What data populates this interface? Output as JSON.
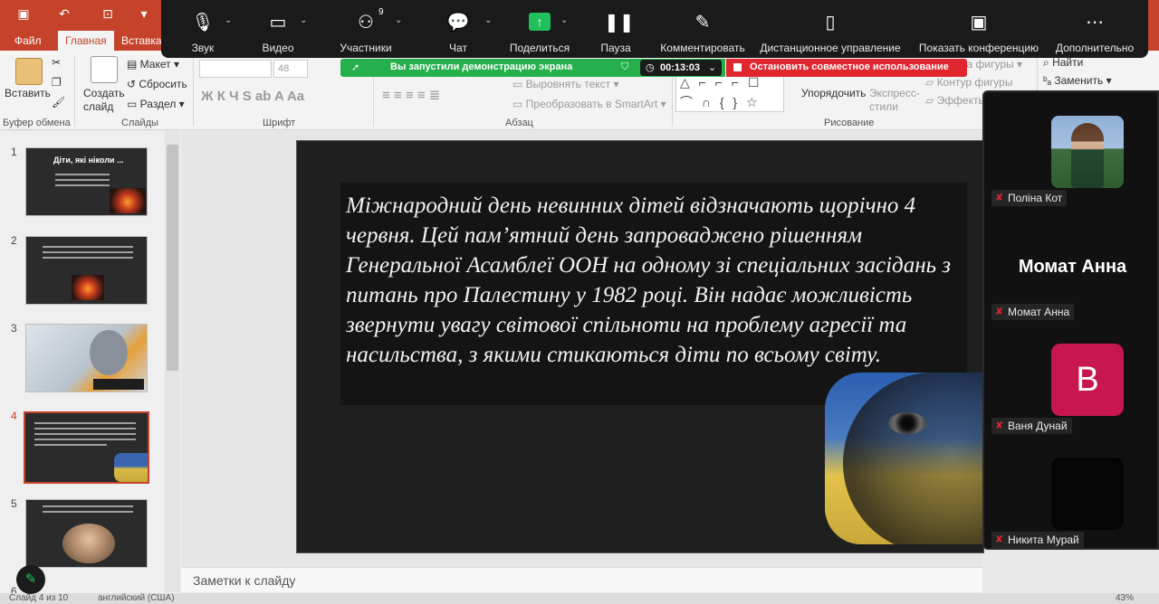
{
  "ppt": {
    "tabs": [
      {
        "label": "Файл"
      },
      {
        "label": "Главная"
      },
      {
        "label": "Вставка"
      }
    ],
    "ribbon": {
      "paste_label": "Вставить",
      "clipboard_group": "Буфер обмена",
      "new_slide_label": "Создать слайд",
      "layout_label": "Макет",
      "reset_label": "Сбросить",
      "section_label": "Раздел",
      "slides_group": "Слайды",
      "font_size": "48",
      "font_group": "Шрифт",
      "align_text_label": "Выровнять текст",
      "smartart_label": "Преобразовать в SmartArt",
      "paragraph_group": "Абзац",
      "arrange_label": "Упорядочить",
      "quick_styles_label": "Экспресс-стили",
      "shape_fill_label": "ка фигуры",
      "shape_outline_label": "Контур фигуры",
      "effects_label": "Эффекты",
      "drawing_group": "Рисование",
      "find_label": "Найти",
      "replace_label": "Заменить"
    },
    "slides": [
      {
        "num": "1",
        "title": "Діти, які ніколи ..."
      },
      {
        "num": "2"
      },
      {
        "num": "3"
      },
      {
        "num": "4"
      },
      {
        "num": "5"
      },
      {
        "num": "6"
      }
    ],
    "current_slide_text": " Міжнародний день невинних дітей відзначають щорічно 4 червня. Цей пам’ятний день запроваджено рішенням Генеральної Асамблеї ООН на одному зі спеціальних засідань з питань про Палестину у 1982 році. Він надає можливість звернути увагу світової спільноти на проблему агресії та насильства, з якими стикаються діти по всьому світу.",
    "notes_placeholder": "Заметки к слайду",
    "status": {
      "slide_counter": "Слайд 4 из 10",
      "language": "английский (США)",
      "zoom": "43%"
    }
  },
  "zoom": {
    "toolbar": [
      {
        "label": "Звук",
        "icon": "microphone-icon"
      },
      {
        "label": "Видео",
        "icon": "video-camera-icon"
      },
      {
        "label": "Участники",
        "icon": "participants-icon",
        "badge": "9"
      },
      {
        "label": "Чат",
        "icon": "chat-icon"
      },
      {
        "label": "Поделиться",
        "icon": "share-screen-icon"
      },
      {
        "label": "Пауза",
        "icon": "pause-icon"
      },
      {
        "label": "Комментировать",
        "icon": "annotate-pencil-icon"
      },
      {
        "label": "Дистанционное управление",
        "icon": "remote-control-mouse-icon"
      },
      {
        "label": "Показать конференцию",
        "icon": "show-meeting-icon"
      },
      {
        "label": "Дополнительно",
        "icon": "more-icon"
      }
    ],
    "share_banner": "Вы запустили демонстрацию экрана",
    "timer": "00:13:03",
    "stop_share": "Остановить совместное использование",
    "participants": [
      {
        "name": "Поліна Кот",
        "avatar": "photo"
      },
      {
        "name": "Момат Анна",
        "avatar": "name",
        "display_name": "Момат Анна"
      },
      {
        "name": "Ваня Дунай",
        "avatar": "letter",
        "letter": "B",
        "color": "#c8164f"
      },
      {
        "name": "Никита Мурай",
        "avatar": "dark"
      }
    ]
  },
  "colors": {
    "ppt_accent": "#c5432a",
    "share_green": "#25b04c",
    "stop_red": "#e0262f"
  }
}
